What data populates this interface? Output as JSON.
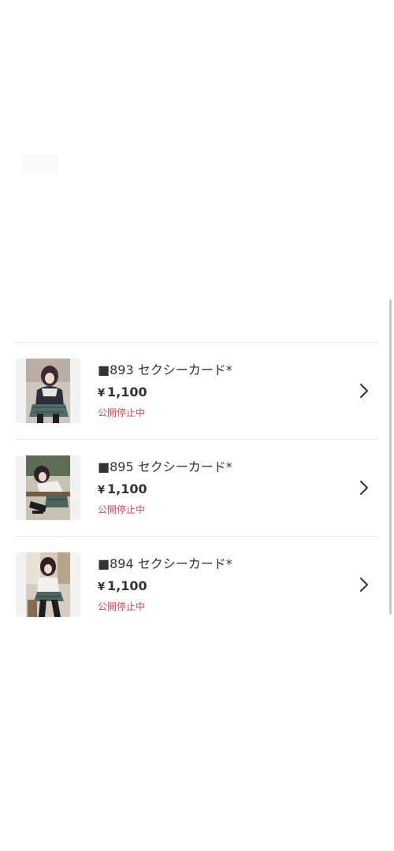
{
  "listing": {
    "items": [
      {
        "title": "■893 セクシーカード*",
        "currency": "¥",
        "price": "1,100",
        "status": "公開停止中",
        "thumbnail": "photo-card-schoolgirl-seated"
      },
      {
        "title": "■895 セクシーカード*",
        "currency": "¥",
        "price": "1,100",
        "status": "公開停止中",
        "thumbnail": "photo-card-schoolgirl-desk"
      },
      {
        "title": "■894 セクシーカード*",
        "currency": "¥",
        "price": "1,100",
        "status": "公開停止中",
        "thumbnail": "photo-card-schoolgirl-classroom"
      }
    ]
  },
  "colors": {
    "status_red": "#e0454b",
    "text": "#333333",
    "divider": "#e6e6e6"
  },
  "icons": {
    "chevron": "chevron-right-icon"
  }
}
